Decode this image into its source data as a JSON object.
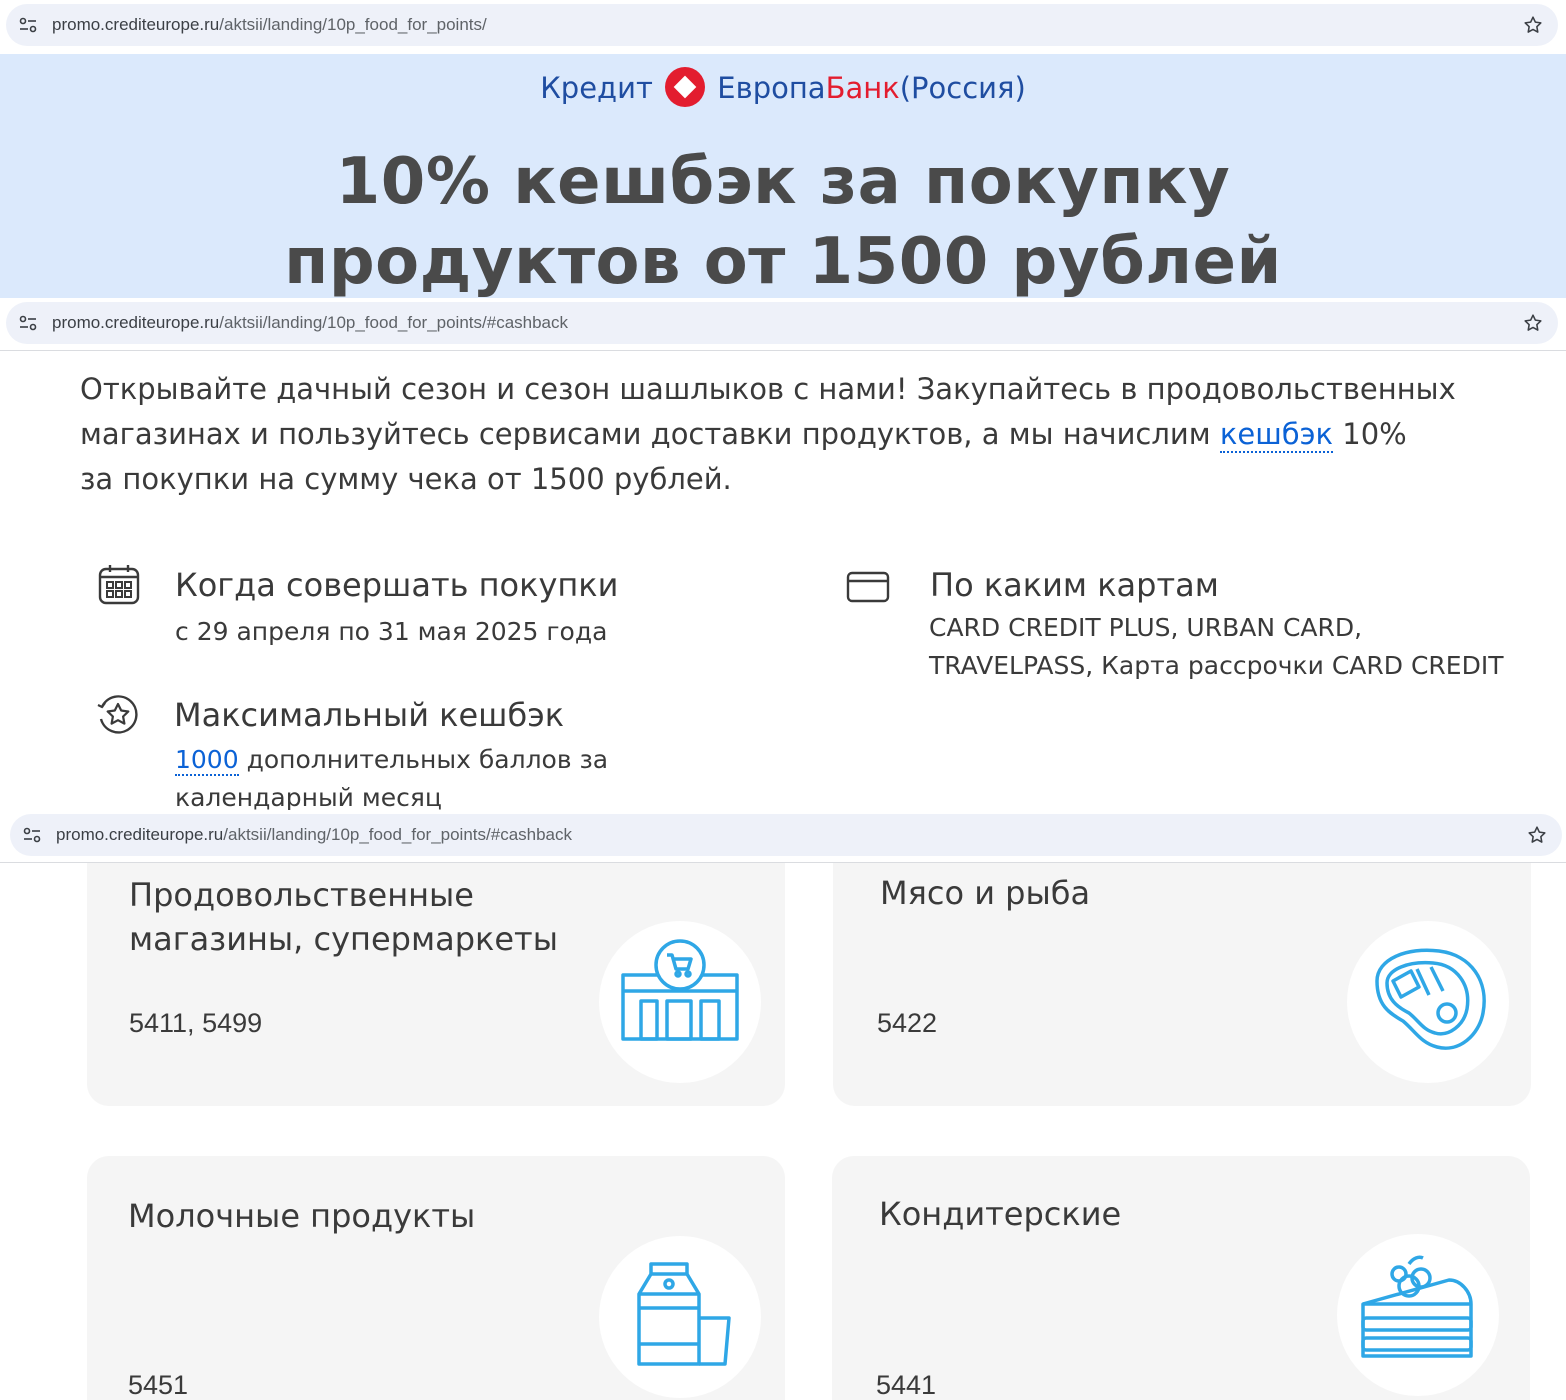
{
  "browser": {
    "bars": [
      {
        "url_host": "promo.crediteurope.ru",
        "url_path": "/aktsii/landing/10p_food_for_points/"
      },
      {
        "url_host": "promo.crediteurope.ru",
        "url_path": "/aktsii/landing/10p_food_for_points/#cashback"
      },
      {
        "url_host": "promo.crediteurope.ru",
        "url_path": "/aktsii/landing/10p_food_for_points/#cashback"
      }
    ]
  },
  "hero": {
    "logo": {
      "part1": "Кредит",
      "part2": "Европа",
      "part3": "Банк",
      "part4": "(Россия)"
    },
    "title_line1": "10% кешбэк за покупку",
    "title_line2": "продуктов от 1500 рублей"
  },
  "intro": {
    "text_before": "Открывайте дачный сезон и сезон шашлыков с нами! Закупайтесь в продовольственных магазинах и пользуйтесь сервисами доставки продуктов, а мы начислим ",
    "link": "кешбэк",
    "text_after_1": " 10%",
    "text_after_2": "за покупки на сумму чека от 1500 рублей."
  },
  "details": {
    "when": {
      "title": "Когда совершать покупки",
      "text": "с 29 апреля по 31 мая 2025 года",
      "icon": "calendar-icon"
    },
    "cards": {
      "title": "По каким картам",
      "line1": "CARD CREDIT PLUS, URBAN CARD,",
      "line2": "TRAVELPASS, Карта рассрочки CARD CREDIT",
      "icon": "credit-card-icon"
    },
    "max": {
      "title": "Максимальный кешбэк",
      "amount": "1000",
      "text1": " дополнительных баллов за",
      "text2": "календарный месяц",
      "icon": "star-badge-icon"
    }
  },
  "categories": [
    {
      "title1": "Продовольственные",
      "title2": "магазины, супермаркеты",
      "codes": "5411, 5499",
      "icon": "supermarket-icon"
    },
    {
      "title1": "Мясо и рыба",
      "title2": "",
      "codes": "5422",
      "icon": "steak-icon"
    },
    {
      "title1": "Молочные продукты",
      "title2": "",
      "codes": "5451",
      "icon": "milk-icon"
    },
    {
      "title1": "Кондитерские",
      "title2": "",
      "codes": "5441",
      "icon": "cake-icon"
    }
  ],
  "colors": {
    "accent": "#0b62d6",
    "icon_blue": "#2fa7e6",
    "hero_bg": "#dbe9fc",
    "brand_blue": "#1f4da1",
    "brand_red": "#e31d2f"
  }
}
